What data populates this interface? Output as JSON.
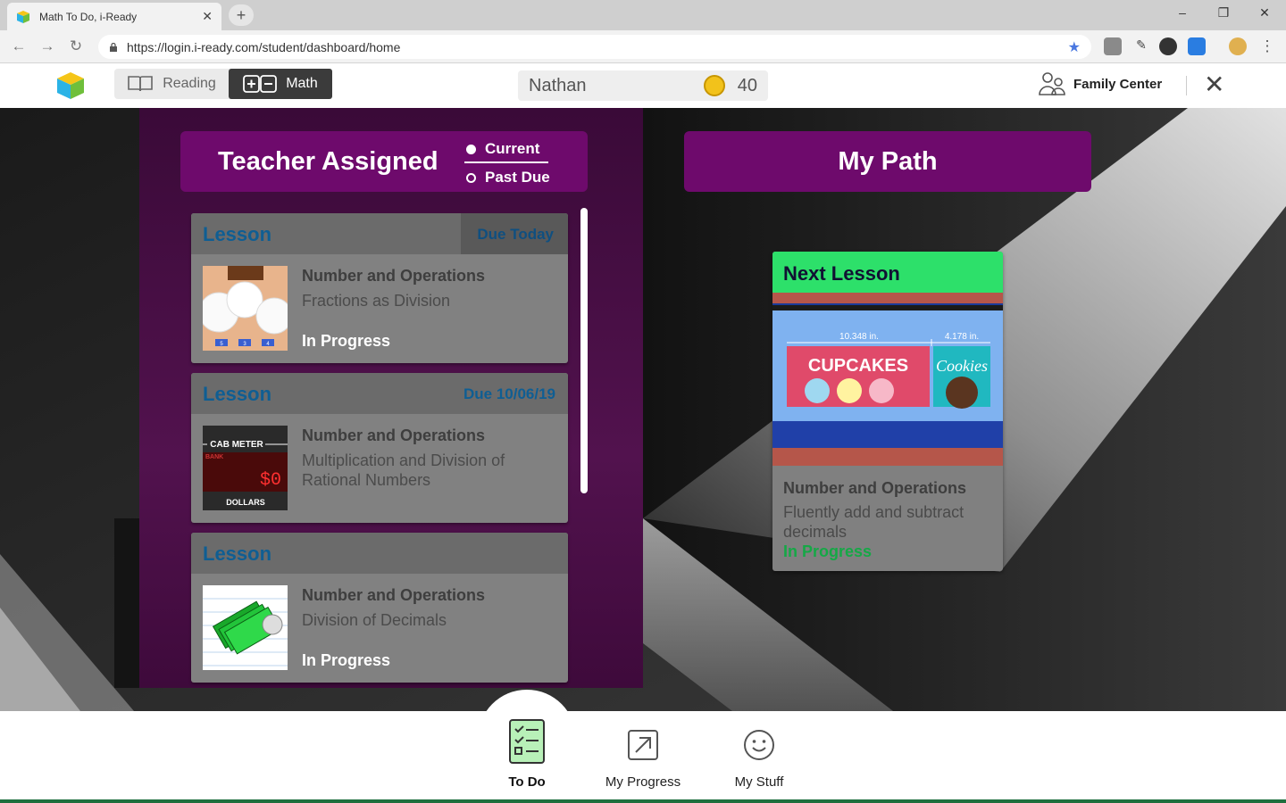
{
  "browser": {
    "tab_title": "Math To Do, i-Ready",
    "tab_close": "✕",
    "new_tab": "+",
    "url": "https://login.i-ready.com/student/dashboard/home",
    "window_controls": [
      "–",
      "❐",
      "✕"
    ]
  },
  "header": {
    "subjects": [
      {
        "label": "Reading",
        "active": false
      },
      {
        "label": "Math",
        "active": true
      }
    ],
    "student_name": "Nathan",
    "coins": "40",
    "family_center": "Family Center",
    "close": "✕"
  },
  "teacher_assigned": {
    "title": "Teacher Assigned",
    "filters": [
      {
        "label": "Current",
        "selected": true
      },
      {
        "label": "Past Due",
        "selected": false
      }
    ],
    "lessons": [
      {
        "type": "Lesson",
        "due": "Due Today",
        "domain": "Number and Operations",
        "topic": "Fractions as Division",
        "status": "In Progress",
        "thumb": "plates-icon"
      },
      {
        "type": "Lesson",
        "due": "Due 10/06/19",
        "domain": "Number and Operations",
        "topic": "Multiplication and Division of Rational Numbers",
        "status": "",
        "thumb": "cab-meter-icon"
      },
      {
        "type": "Lesson",
        "due": "",
        "domain": "Number and Operations",
        "topic": "Division of Decimals",
        "status": "In Progress",
        "thumb": "money-icon"
      }
    ],
    "cab_meter": {
      "title": "CAB METER",
      "small": "BANK",
      "amount": "$0",
      "unit": "DOLLARS"
    },
    "plate_numbers": [
      "5",
      "3",
      "4"
    ]
  },
  "my_path": {
    "title": "My Path",
    "next_lesson": {
      "header": "Next Lesson",
      "domain": "Number and Operations",
      "topic": "Fluently add and subtract decimals",
      "status": "In Progress",
      "image": {
        "measure1": "10.348 in.",
        "measure2": "4.178 in.",
        "sign1": "CUPCAKES",
        "sign2": "Cookies"
      }
    }
  },
  "bottom_nav": [
    {
      "label": "To Do",
      "icon": "checklist-icon",
      "active": true
    },
    {
      "label": "My Progress",
      "icon": "progress-arrow-icon",
      "active": false
    },
    {
      "label": "My Stuff",
      "icon": "smiley-icon",
      "active": false
    }
  ],
  "colors": {
    "accent_purple": "#6e0a6c",
    "next_lesson_green": "#2de06a",
    "lesson_blue": "#0f5e93",
    "in_progress_green": "#15a846"
  }
}
